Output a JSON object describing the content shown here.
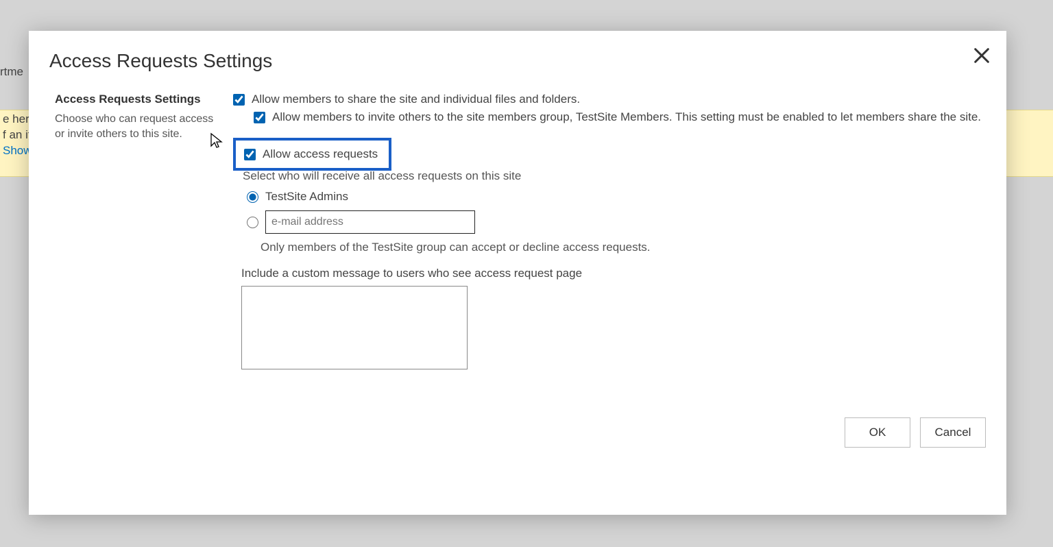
{
  "background": {
    "top_fragment": "rtme",
    "yellow_line1": "e her",
    "yellow_line2": "f an it",
    "yellow_line3_link": "Show"
  },
  "dialog": {
    "title": "Access Requests Settings",
    "section_heading": "Access Requests Settings",
    "section_desc": "Choose who can request access or invite others to this site.",
    "cb_share_label": "Allow members to share the site and individual files and folders.",
    "cb_invite_label": "Allow members to invite others to the site members group, TestSite Members. This setting must be enabled to let members share the site.",
    "cb_allow_label": "Allow access requests",
    "sub_select_label": "Select who will receive all access requests on this site",
    "radio_admins_label": "TestSite Admins",
    "email_placeholder": "e-mail address",
    "note_text": "Only members of the TestSite group can accept or decline access requests.",
    "custom_msg_label": "Include a custom message to users who see access request page",
    "ok_label": "OK",
    "cancel_label": "Cancel",
    "cb_share_checked": true,
    "cb_invite_checked": true,
    "cb_allow_checked": true,
    "radio_admins_selected": true,
    "radio_email_selected": false
  }
}
